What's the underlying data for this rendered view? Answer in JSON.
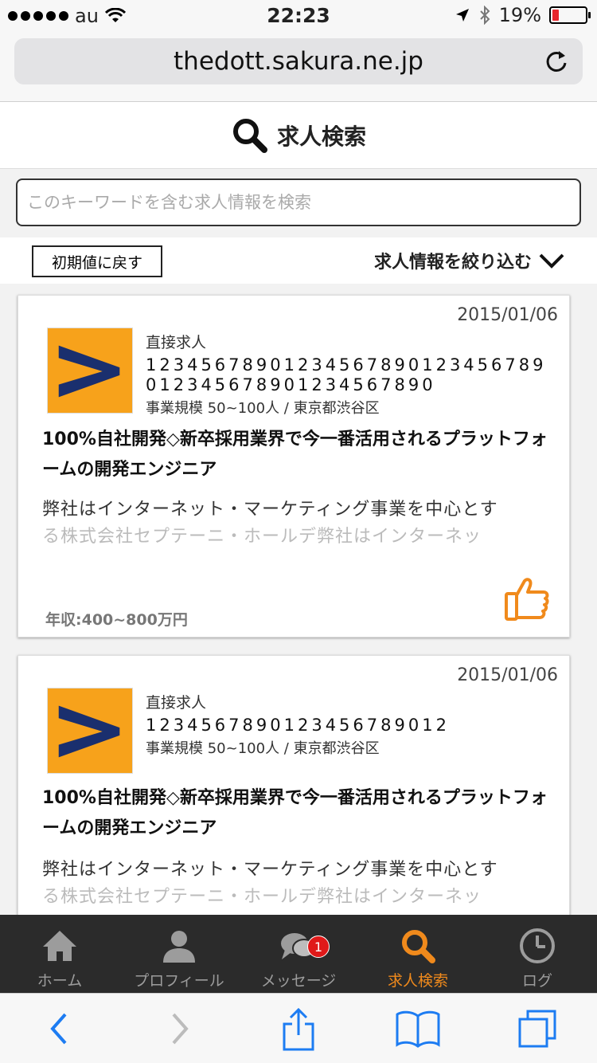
{
  "status_bar": {
    "carrier": "au",
    "time": "22:23",
    "battery": "19%",
    "battery_level": 0.19
  },
  "browser": {
    "url": "thedott.sakura.ne.jp"
  },
  "page": {
    "title": "求人検索"
  },
  "search": {
    "placeholder": "このキーワードを含む求人情報を検索"
  },
  "filters": {
    "reset_label": "初期値に戻す",
    "narrow_label": "求人情報を絞り込む"
  },
  "jobs": [
    {
      "date": "2015/01/06",
      "type": "直接求人",
      "company": "12345678901234567890123456789012345678901234567890",
      "scale": "事業規模 50~100人 / 東京都渋谷区",
      "title": "100%自社開発◇新卒採用業界で今一番活用されるプラットフォームの開発エンジニア",
      "desc_visible": "弊社はインターネット・マーケティング事業を中心とす",
      "desc_faded": "る株式会社セプテーニ・ホールデ弊社はインターネッ",
      "salary": "年収:400~800万円"
    },
    {
      "date": "2015/01/06",
      "type": "直接求人",
      "company": "1234567890123456789012",
      "scale": "事業規模 50~100人 / 東京都渋谷区",
      "title": "100%自社開発◇新卒採用業界で今一番活用されるプラットフォームの開発エンジニア",
      "desc_visible": "弊社はインターネット・マーケティング事業を中心とす",
      "desc_faded": "る株式会社セプテーニ・ホールデ弊社はインターネッ"
    }
  ],
  "tabs": [
    {
      "label": "ホーム",
      "icon": "home-icon"
    },
    {
      "label": "プロフィール",
      "icon": "profile-icon"
    },
    {
      "label": "メッセージ",
      "icon": "message-icon",
      "badge": "1"
    },
    {
      "label": "求人検索",
      "icon": "search-icon",
      "active": true
    },
    {
      "label": "ログ",
      "icon": "clock-icon"
    }
  ],
  "colors": {
    "accent": "#f08a1c",
    "logo_bg": "#f7a21b",
    "logo_chevron": "#1a2f6e",
    "badge": "#e01919",
    "ios_blue": "#1d7cf2"
  }
}
